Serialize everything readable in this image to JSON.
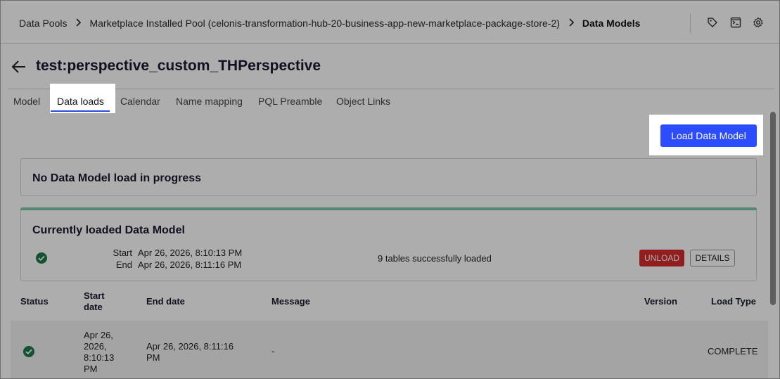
{
  "breadcrumb": {
    "items": [
      {
        "label": "Data Pools"
      },
      {
        "label": "Marketplace Installed Pool (celonis-transformation-hub-20-business-app-new-marketplace-package-store-2)"
      },
      {
        "label": "Data Models"
      }
    ]
  },
  "header": {
    "title": "test:perspective_custom_THPerspective"
  },
  "tabs": [
    {
      "label": "Model"
    },
    {
      "label": "Data loads"
    },
    {
      "label": "Calendar"
    },
    {
      "label": "Name mapping"
    },
    {
      "label": "PQL Preamble"
    },
    {
      "label": "Object Links"
    }
  ],
  "active_tab": "Data loads",
  "actions": {
    "load_label": "Load Data Model"
  },
  "progress_card": {
    "title": "No Data Model load in progress"
  },
  "current_card": {
    "title": "Currently loaded Data Model",
    "start_label": "Start",
    "start_value": "Apr 26, 2026, 8:10:13 PM",
    "end_label": "End",
    "end_value": "Apr 26, 2026, 8:11:16 PM",
    "message": "9 tables successfully loaded",
    "unload_label": "UNLOAD",
    "details_label": "DETAILS"
  },
  "table": {
    "headers": {
      "status": "Status",
      "start_date_line1": "Start",
      "start_date_line2": "date",
      "end_date": "End date",
      "message": "Message",
      "version": "Version",
      "load_type": "Load Type"
    },
    "rows": [
      {
        "start_line1": "Apr 26,",
        "start_line2": "2026,",
        "start_line3": "8:10:13",
        "start_line4": "PM",
        "end_line1": "Apr 26, 2026, 8:11:16",
        "end_line2": "PM",
        "message": "-",
        "version": "",
        "load_type": "COMPLETE"
      }
    ]
  },
  "colors": {
    "accent": "#2b4cff",
    "success": "#1f7a4d",
    "danger": "#d62d2d",
    "card_accent": "#7bc9a5"
  }
}
